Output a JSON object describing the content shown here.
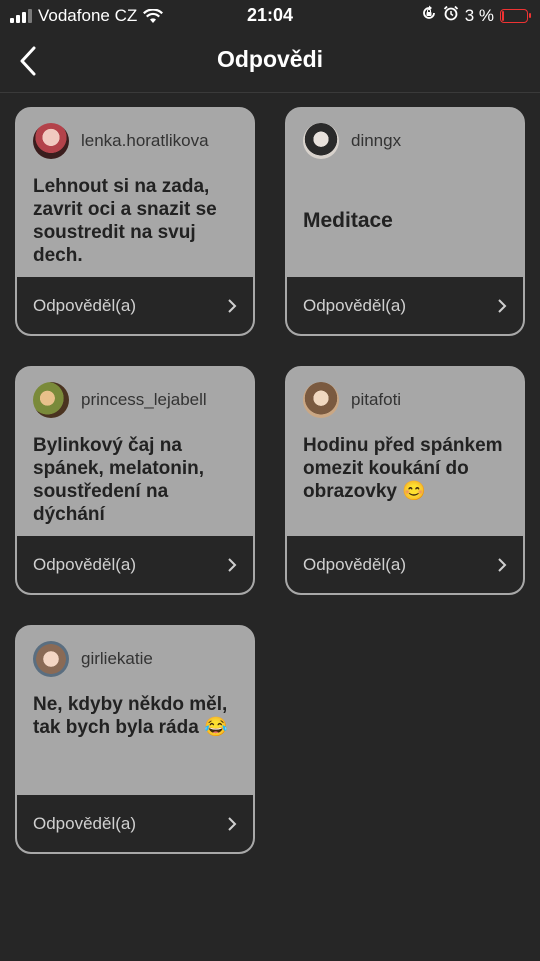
{
  "status_bar": {
    "carrier": "Vodafone CZ",
    "time": "21:04",
    "battery_percent": "3 %",
    "battery_level": 0.03,
    "icons": [
      "signal-icon",
      "wifi-icon",
      "rotation-lock-icon",
      "alarm-icon",
      "battery-icon"
    ]
  },
  "header": {
    "title": "Odpovědi",
    "back_icon": "chevron-left-icon"
  },
  "cards": [
    {
      "username": "lenka.horatlikova",
      "answer": "Lehnout si na zada, zavrit oci a snazit se soustredit na svuj dech.",
      "status": "Odpověděl(a)"
    },
    {
      "username": "dinngx",
      "answer": "Meditace",
      "status": "Odpověděl(a)"
    },
    {
      "username": "princess_lejabell",
      "answer": "Bylinkový čaj na spánek, melatonin, soustředení na dýchání",
      "status": "Odpověděl(a)"
    },
    {
      "username": "pitafoti",
      "answer": "Hodinu před spánkem omezit koukání do obrazovky 😊",
      "status": "Odpověděl(a)"
    },
    {
      "username": "girliekatie",
      "answer": "Ne, kdyby někdo měl, tak bych byla ráda 😂",
      "status": "Odpověděl(a)"
    }
  ],
  "colors": {
    "background": "#262626",
    "card": "#a7a7a7",
    "battery_low": "#e33333"
  }
}
